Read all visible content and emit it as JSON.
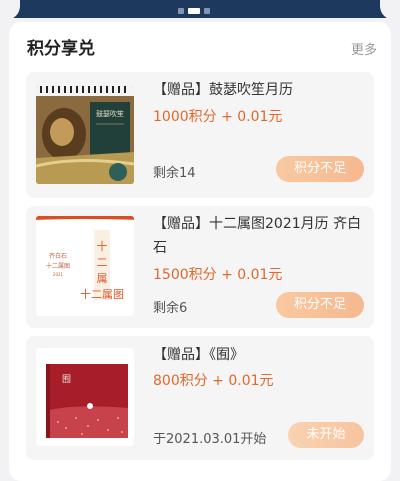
{
  "section": {
    "title": "积分享兑",
    "more": "更多"
  },
  "items": [
    {
      "title": "【赠品】鼓瑟吹笙月历",
      "price": "1000积分 + 0.01元",
      "status": "剩余14",
      "button": "积分不足",
      "cover_text": "鼓瑟吹笙"
    },
    {
      "title": "【赠品】十二属图2021月历 齐白石",
      "price": "1500积分 + 0.01元",
      "status": "剩余6",
      "button": "积分不足",
      "cover_text": "十二属图"
    },
    {
      "title": "【赠品】《囿》",
      "price": "800积分 + 0.01元",
      "status": "于2021.03.01开始",
      "button": "未开始",
      "cover_text": "囿"
    }
  ]
}
